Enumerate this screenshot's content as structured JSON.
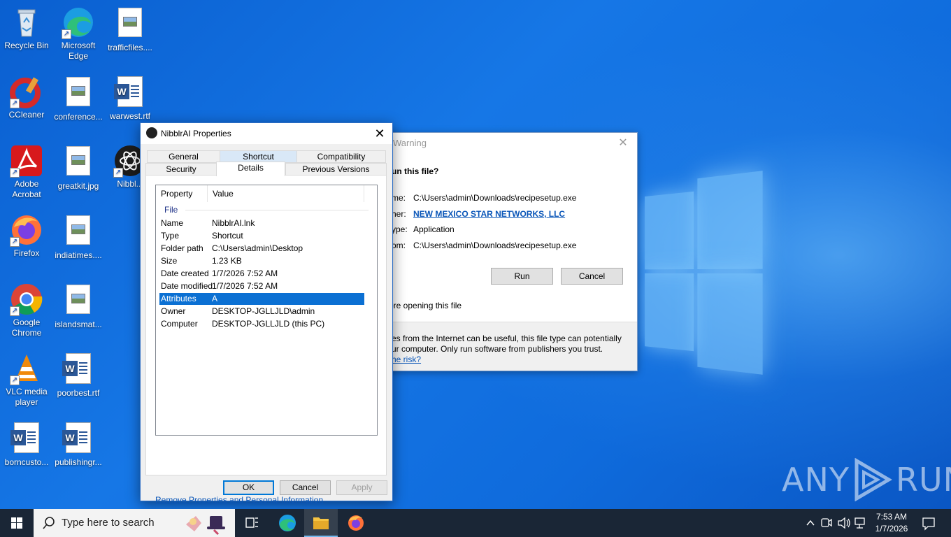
{
  "desktop": {
    "icons": [
      {
        "label": "Recycle Bin"
      },
      {
        "label": "Microsoft Edge"
      },
      {
        "label": "trafficfiles...."
      },
      {
        "label": "CCleaner"
      },
      {
        "label": "conference..."
      },
      {
        "label": "warwest.rtf"
      },
      {
        "label": "Adobe Acrobat"
      },
      {
        "label": "greatkit.jpg"
      },
      {
        "label": "Nibbl..."
      },
      {
        "label": "Firefox"
      },
      {
        "label": "indiatimes...."
      },
      {
        "label": "Google Chrome"
      },
      {
        "label": "islandsmat..."
      },
      {
        "label": "VLC media player"
      },
      {
        "label": "poorbest.rtf"
      },
      {
        "label": "borncusto..."
      },
      {
        "label": "publishingr..."
      }
    ],
    "watermark": {
      "left": "ANY",
      "right": "RUN"
    }
  },
  "warning_dialog": {
    "title": "Warning",
    "question": "un this file?",
    "name_label": "me:",
    "name_value": "C:\\Users\\admin\\Downloads\\recipesetup.exe",
    "publisher_label": "her:",
    "publisher_value": "NEW MEXICO STAR NETWORKS, LLC",
    "type_label": "ype:",
    "type_value": "Application",
    "from_label": "om:",
    "from_value": "C:\\Users\\admin\\Downloads\\recipesetup.exe",
    "run_button": "Run",
    "cancel_button": "Cancel",
    "checkbox_text": "ore opening this file",
    "info_line1": "es from the Internet can be useful, this file type can potentially",
    "info_line2": "ur computer. Only run software from publishers you trust.",
    "risk_link": "he risk?"
  },
  "properties_dialog": {
    "title": "NibblrAI Properties",
    "tabs_row1": [
      "General",
      "Shortcut",
      "Compatibility"
    ],
    "tabs_row2": [
      "Security",
      "Details",
      "Previous Versions"
    ],
    "columns": [
      "Property",
      "Value"
    ],
    "group": "File",
    "rows": [
      {
        "key": "Name",
        "value": "NibblrAI.lnk"
      },
      {
        "key": "Type",
        "value": "Shortcut"
      },
      {
        "key": "Folder path",
        "value": "C:\\Users\\admin\\Desktop"
      },
      {
        "key": "Size",
        "value": "1.23 KB"
      },
      {
        "key": "Date created",
        "value": "1/7/2026 7:52 AM"
      },
      {
        "key": "Date modified",
        "value": "1/7/2026 7:52 AM"
      },
      {
        "key": "Attributes",
        "value": "A"
      },
      {
        "key": "Owner",
        "value": "DESKTOP-JGLLJLD\\admin"
      },
      {
        "key": "Computer",
        "value": "DESKTOP-JGLLJLD (this PC)"
      }
    ],
    "remove_link": "Remove Properties and Personal Information",
    "ok_button": "OK",
    "cancel_button": "Cancel",
    "apply_button": "Apply"
  },
  "taskbar": {
    "search_placeholder": "Type here to search",
    "time": "7:53 AM",
    "date": "1/7/2026"
  }
}
